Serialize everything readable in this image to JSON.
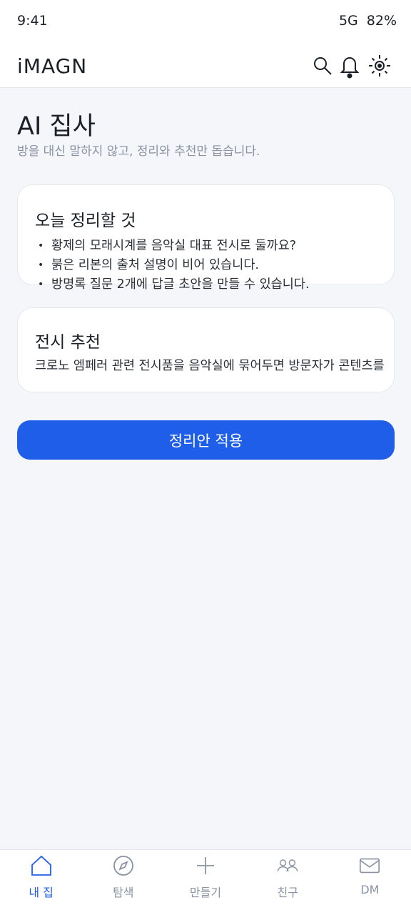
{
  "status": {
    "time": "9:41",
    "network": "5G",
    "battery": "82%"
  },
  "header": {
    "brand": "iMAGN",
    "icons": [
      "search-icon",
      "bell-icon",
      "brightness-icon"
    ]
  },
  "page": {
    "title": "AI 집사",
    "subtitle": "방을 대신 말하지 않고, 정리와 추천만 돕습니다."
  },
  "today_card": {
    "title": "오늘 정리할 것",
    "items": [
      "황제의 모래시계를 음악실 대표 전시로 둘까요?",
      "붉은 리본의 출처 설명이 비어 있습니다.",
      "방명록 질문 2개에 답글 초안을 만들 수 있습니다."
    ]
  },
  "recommend_card": {
    "title": "전시 추천",
    "body": "크로노 엠페러 관련 전시품을 음악실에 묶어두면 방문자가 콘텐츠를"
  },
  "apply_button": {
    "label": "정리안 적용"
  },
  "tabs": [
    {
      "label": "내 집",
      "icon": "home-icon",
      "active": true
    },
    {
      "label": "탐색",
      "icon": "compass-icon",
      "active": false
    },
    {
      "label": "만들기",
      "icon": "plus-icon",
      "active": false
    },
    {
      "label": "친구",
      "icon": "friends-icon",
      "active": false
    },
    {
      "label": "DM",
      "icon": "mail-icon",
      "active": false
    }
  ],
  "colors": {
    "accent": "#1f5ee8",
    "background": "#f4f6f9",
    "muted": "#8a93a3"
  }
}
